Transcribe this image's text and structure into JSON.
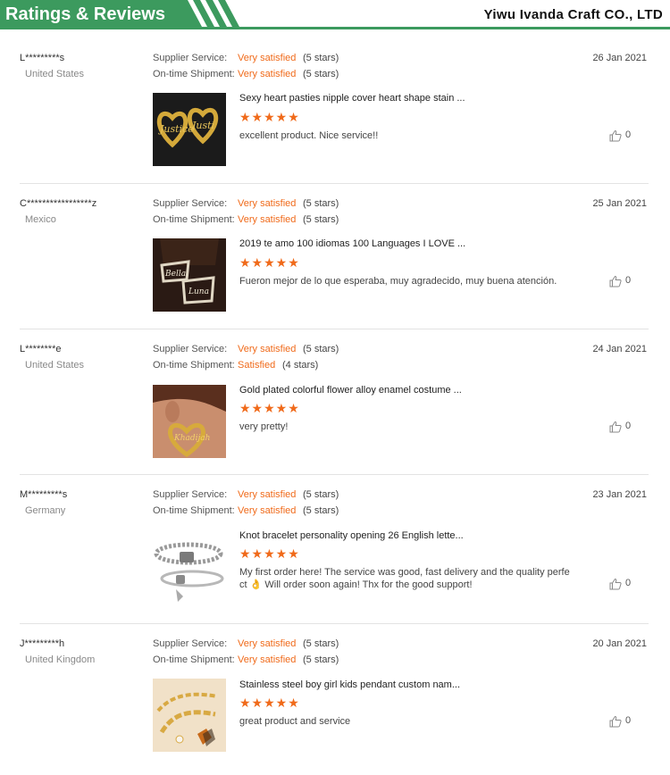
{
  "header": {
    "title": "Ratings & Reviews",
    "company": "Yiwu Ivanda Craft CO., LTD",
    "accent_color": "#3c9a5e"
  },
  "labels": {
    "supplier_service": "Supplier Service:",
    "ontime_shipment": "On-time Shipment:"
  },
  "reviews": [
    {
      "user": "L*********s",
      "country": "United States",
      "supplier_rating": "Very satisfied",
      "supplier_stars": "(5 stars)",
      "shipment_rating": "Very satisfied",
      "shipment_stars": "(5 stars)",
      "date": "26 Jan 2021",
      "product": "Sexy heart pasties nipple cover heart shape stain ...",
      "stars": "★★★★★",
      "comment": "excellent product. Nice service!!",
      "likes": "0",
      "image": "gold-heart-name-earrings"
    },
    {
      "user": "C*****************z",
      "country": "Mexico",
      "supplier_rating": "Very satisfied",
      "supplier_stars": "(5 stars)",
      "shipment_rating": "Very satisfied",
      "shipment_stars": "(5 stars)",
      "date": "25 Jan 2021",
      "product": "2019 te amo 100 idiomas 100 Languages I LOVE ...",
      "stars": "★★★★★",
      "comment": "Fueron mejor de lo que esperaba, muy agradecido, muy buena atención.",
      "likes": "0",
      "image": "name-earrings-on-dark"
    },
    {
      "user": "L********e",
      "country": "United States",
      "supplier_rating": "Very satisfied",
      "supplier_stars": "(5 stars)",
      "shipment_rating": "Satisfied",
      "shipment_stars": "(4 stars)",
      "date": "24 Jan 2021",
      "product": "Gold plated colorful flower alloy enamel costume ...",
      "stars": "★★★★★",
      "comment": "very pretty!",
      "likes": "0",
      "image": "heart-earring-worn"
    },
    {
      "user": "M*********s",
      "country": "Germany",
      "supplier_rating": "Very satisfied",
      "supplier_stars": "(5 stars)",
      "shipment_rating": "Very satisfied",
      "shipment_stars": "(5 stars)",
      "date": "23 Jan 2021",
      "product": "Knot bracelet personality opening 26 English lette...",
      "stars": "★★★★★",
      "comment": "My first order here! The service was good, fast delivery and the quality perfe ct 👌 Will order soon again! Thx for the good support!",
      "likes": "0",
      "image": "silver-lock-bracelets"
    },
    {
      "user": "J*********h",
      "country": "United Kingdom",
      "supplier_rating": "Very satisfied",
      "supplier_stars": "(5 stars)",
      "shipment_rating": "Very satisfied",
      "shipment_stars": "(5 stars)",
      "date": "20 Jan 2021",
      "product": "Stainless steel boy girl kids pendant custom nam...",
      "stars": "★★★★★",
      "comment": "great product and service",
      "likes": "0",
      "image": "gold-chain-bracelet-butterfly"
    }
  ]
}
